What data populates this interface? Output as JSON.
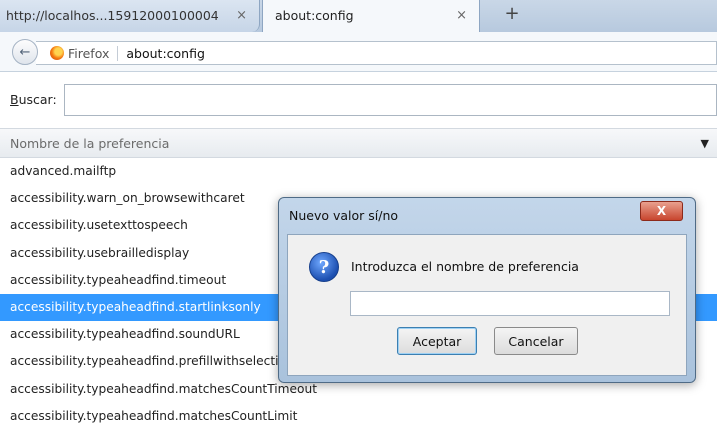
{
  "tabs": [
    {
      "label": "http://localhos...15912000100004",
      "close": "×"
    },
    {
      "label": "about:config",
      "close": "×"
    }
  ],
  "new_tab": "+",
  "navbar": {
    "back_arrow": "←",
    "identity_label": "Firefox",
    "url": "about:config"
  },
  "search": {
    "label_underlined": "B",
    "label_rest": "uscar:",
    "value": ""
  },
  "column_header": {
    "label": "Nombre de la preferencia",
    "sort_icon": "▼"
  },
  "prefs": [
    {
      "name": "advanced.mailftp"
    },
    {
      "name": "accessibility.warn_on_browsewithcaret"
    },
    {
      "name": "accessibility.usetexttospeech"
    },
    {
      "name": "accessibility.usebrailledisplay"
    },
    {
      "name": "accessibility.typeaheadfind.timeout"
    },
    {
      "name": "accessibility.typeaheadfind.startlinksonly",
      "selected": true
    },
    {
      "name": "accessibility.typeaheadfind.soundURL"
    },
    {
      "name": "accessibility.typeaheadfind.prefillwithselection"
    },
    {
      "name": "accessibility.typeaheadfind.matchesCountTimeout"
    },
    {
      "name": "accessibility.typeaheadfind.matchesCountLimit"
    }
  ],
  "dialog": {
    "title": "Nuevo valor sí/no",
    "close_label": "X",
    "icon": "?",
    "prompt": "Introduzca el nombre de preferencia",
    "input_value": "",
    "ok_label": "Aceptar",
    "cancel_label": "Cancelar"
  },
  "colors": {
    "selection": "#3399ff",
    "dialog_frame": "#a9c2dc",
    "close_button": "#c8452e"
  }
}
